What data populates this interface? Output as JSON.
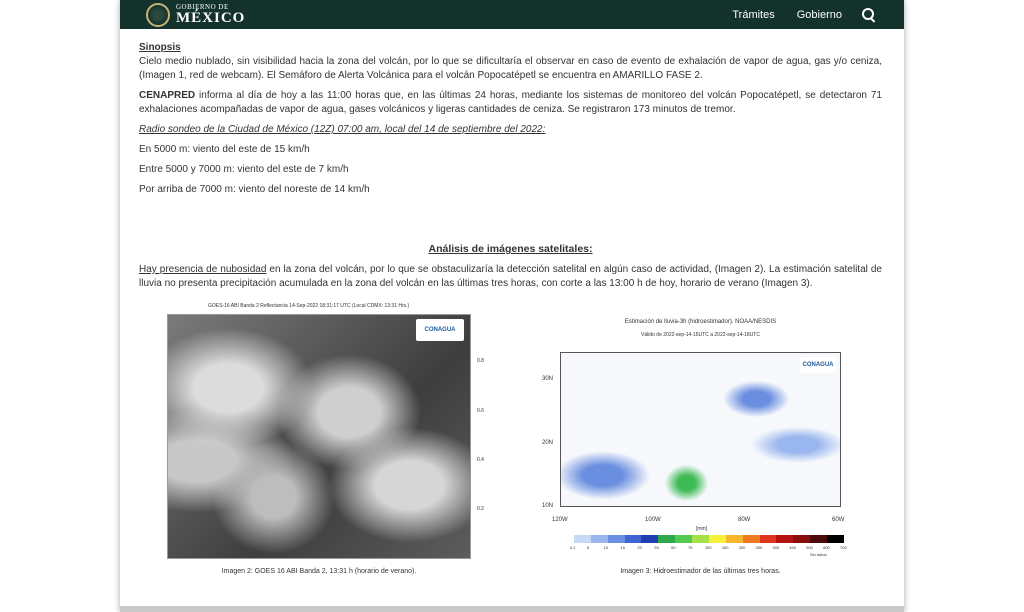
{
  "header": {
    "logo_small": "GOBIERNO DE",
    "logo_big": "MÉXICO",
    "nav": [
      "Trámites",
      "Gobierno"
    ],
    "bg_color": "#13322b"
  },
  "sinopsis": {
    "title": "Sinopsis",
    "text": "Cielo medio nublado, sin visibilidad hacia la zona del volcán, por lo que se dificultaría el observar en caso de evento de exhalación de vapor de agua, gas y/o ceniza, (Imagen 1, red de webcam). El Semáforo de Alerta Volcánica para el volcán Popocatépetl se encuentra en AMARILLO FASE 2."
  },
  "cenapred": {
    "bold": "CENAPRED",
    "text": " informa al día de hoy a las 11:00 horas que, en las últimas 24 horas, mediante los sistemas de monitoreo del volcán Popocatépetl, se detectaron 71 exhalaciones acompañadas de vapor de agua, gases volcánicos y ligeras cantidades de ceniza. Se registraron 173 minutos de tremor."
  },
  "radio": {
    "title": "Radio sondeo de la Ciudad de México (12Z) 07:00 am, local del 14 de septiembre del 2022:",
    "lines": [
      "En 5000 m: viento del este de 15 km/h",
      "Entre 5000 y 7000 m: viento del este de 7 km/h",
      "Por arriba de 7000 m: viento del noreste de 14 km/h"
    ]
  },
  "satellite": {
    "title": "Análisis de imágenes satelitales:",
    "lead": "Hay presencia de nubosidad",
    "text": " en la zona del volcán, por lo que se obstaculizaría la detección satelital en algún caso de actividad, (Imagen 2). La estimación satelital de lluvia no presenta precipitación acumulada en la zona del volcán en las últimas tres horas, con corte a las 13:00 h de hoy, horario de verano (Imagen 3)."
  },
  "image2": {
    "header": "GOES-16 ABI Banda 2 Reflectancia 14-Sep-2022 18:31:17 UTC (Local CDMX: 13:31 Hrs.)",
    "logo": "CONAGUA",
    "scale": [
      "0.8",
      "0.6",
      "0.4",
      "0.2"
    ],
    "caption": "Imagen 2: GOES 16 ABI Banda 2, 13:31 h (horario de verano)."
  },
  "image3": {
    "title": "Estimación de lluvia-3h (hidroestimador). NOAA/NESDIS",
    "subtitle": "Válido de 2022-sep-14-15UTC a 2022-sep-14-18UTC",
    "logo": "CONAGUA",
    "y_labels": [
      "30N",
      "20N",
      "10N"
    ],
    "x_labels": [
      "120W",
      "100W",
      "80W",
      "60W"
    ],
    "unit": "[mm]",
    "bar_labels": [
      "0.1",
      "5",
      "10",
      "15",
      "20",
      "25",
      "50",
      "75",
      "100",
      "150",
      "200",
      "250",
      "300",
      "400",
      "500",
      "600",
      "700"
    ],
    "bar_colors": [
      "#ffffff",
      "#c6d9f7",
      "#9ab6ee",
      "#6b8fe0",
      "#3f65d0",
      "#1f3fb0",
      "#2da84a",
      "#54c94f",
      "#a8e04a",
      "#f6f03a",
      "#f6b62e",
      "#f07a22",
      "#e0351f",
      "#b51414",
      "#8a0d0d",
      "#4d0a0a",
      "#000000"
    ],
    "legend_note": "Sin datos",
    "caption": "Imagen 3: Hidroestimador de las últimas tres horas."
  }
}
